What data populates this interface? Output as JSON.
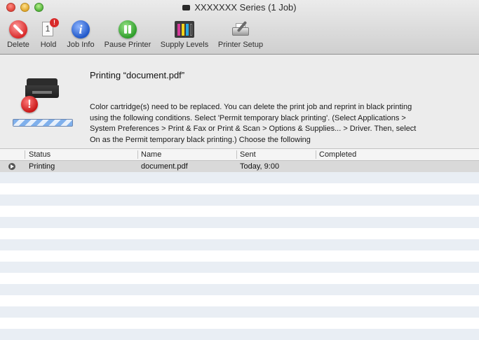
{
  "window": {
    "title": "XXXXXXX  Series (1 Job)",
    "icon": "printer-icon"
  },
  "toolbar": {
    "items": [
      {
        "label": "Delete",
        "icon": "delete-icon"
      },
      {
        "label": "Hold",
        "icon": "hold-icon",
        "badge": "!",
        "page": "1"
      },
      {
        "label": "Job Info",
        "icon": "info-icon",
        "glyph": "i"
      },
      {
        "label": "Pause Printer",
        "icon": "pause-icon"
      },
      {
        "label": "Supply Levels",
        "icon": "ink-levels-icon"
      },
      {
        "label": "Printer Setup",
        "icon": "printer-setup-icon"
      }
    ]
  },
  "status": {
    "title": "Printing “document.pdf”",
    "message": "Color cartridge(s) need to be replaced. You can delete the print job and reprint in black printing using the following conditions. Select 'Permit temporary black printing'. (Select Applications > System Preferences > Print & Fax or Print & Scan > Options & Supplies... > Driver. Then, select On as the Permit temporary black printing.) Choose the following",
    "warning_glyph": "!",
    "progress": "indeterminate"
  },
  "table": {
    "columns": [
      "Status",
      "Name",
      "Sent",
      "Completed"
    ],
    "rows": [
      {
        "status": "Printing",
        "name": "document.pdf",
        "sent": "Today, 9:00",
        "completed": ""
      }
    ]
  },
  "colors": {
    "alert_red": "#d82a2a",
    "info_blue": "#2158c9",
    "pause_green": "#2e9d2a",
    "row_stripe": "#e9eef4",
    "ink": [
      "#d43a9a",
      "#f1d21a",
      "#27a9e1",
      "#1a1a1a"
    ]
  }
}
